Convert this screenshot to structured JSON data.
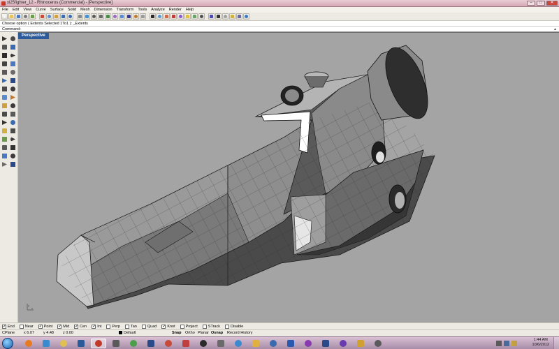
{
  "window": {
    "title": "xl25fighter_12 - Rhinoceros (Commercial) - [Perspective]",
    "minimize": "–",
    "maximize": "□",
    "close": "✕"
  },
  "menu": [
    "File",
    "Edit",
    "View",
    "Curve",
    "Surface",
    "Solid",
    "Mesh",
    "Dimension",
    "Transform",
    "Tools",
    "Analyze",
    "Render",
    "Help"
  ],
  "status_line": "Choose option ( Extents  Selected  1To1 ): _Extents",
  "command_prompt": "Command:",
  "viewport": {
    "tab_label": "Perspective",
    "axis_y": "y",
    "axis_x": "x"
  },
  "toolbar_icons": [
    "new-file-icon",
    "open-file-icon",
    "save-icon",
    "print-icon",
    "import-icon",
    "cut-icon",
    "copy-icon",
    "paste-icon",
    "undo-icon",
    "redo-icon",
    "pan-icon",
    "rotate-view-icon",
    "zoom-icon",
    "zoom-window-icon",
    "zoom-extents-icon",
    "zoom-selected-icon",
    "undo-view-icon",
    "four-views-icon",
    "set-cplane-icon",
    "grid-icon",
    "wireframe-icon",
    "shaded-icon",
    "rendered-icon",
    "render-icon",
    "material-icon",
    "light-icon",
    "layer-icon",
    "properties-icon",
    "osnap-icon",
    "select-icon",
    "hide-icon",
    "lock-icon",
    "options-icon",
    "help-icon"
  ],
  "left_tools": [
    "select-arrow-icon",
    "point-icon",
    "polyline-icon",
    "curve-icon",
    "circle-icon",
    "arc-icon",
    "ellipse-icon",
    "rectangle-icon",
    "polygon-icon",
    "freeform-icon",
    "surface-icon",
    "extrude-icon",
    "box-icon",
    "sphere-icon",
    "mesh-icon",
    "boolean-icon",
    "fillet-icon",
    "offset-icon",
    "trim-icon",
    "split-icon",
    "join-icon",
    "explode-icon",
    "move-icon",
    "copy-object-icon",
    "rotate-icon",
    "scale-icon",
    "mirror-icon",
    "array-icon",
    "dimension-icon",
    "text-icon",
    "group-icon",
    "analyze-icon"
  ],
  "osnaps": [
    {
      "label": "End",
      "checked": true
    },
    {
      "label": "Near",
      "checked": false
    },
    {
      "label": "Point",
      "checked": true
    },
    {
      "label": "Mid",
      "checked": true
    },
    {
      "label": "Cen",
      "checked": true
    },
    {
      "label": "Int",
      "checked": true
    },
    {
      "label": "Perp",
      "checked": false
    },
    {
      "label": "Tan",
      "checked": false
    },
    {
      "label": "Quad",
      "checked": false
    },
    {
      "label": "Knot",
      "checked": true
    },
    {
      "label": "Project",
      "checked": false
    },
    {
      "label": "STrack",
      "checked": false
    },
    {
      "label": "Disable",
      "checked": false
    }
  ],
  "status": {
    "cplane": "CPlane",
    "x": "x 6.07",
    "y": "y 4.48",
    "z": "z 0.00",
    "layer": "Default",
    "snap": "Snap",
    "ortho": "Ortho",
    "planar": "Planar",
    "osnap": "Osnap",
    "record_history": "Record History"
  },
  "taskbar": {
    "time": "1:44 AM",
    "date": "10/6/2012",
    "apps": [
      "firefox-icon",
      "ie-icon",
      "explorer-icon",
      "photoshop-icon",
      "rhino-icon",
      "media-icon",
      "chrome-icon",
      "ps-icon",
      "paint-icon",
      "sketchup-icon",
      "unity-icon",
      "tool-icon",
      "ie2-icon",
      "folder-icon",
      "browser-icon",
      "word-icon",
      "onenote-icon",
      "ps2-icon",
      "ae-icon",
      "winamp-icon",
      "tool2-icon"
    ]
  },
  "colors": {
    "viewport_bg": "#a4a4a4",
    "viewport_tab": "#2c5a9a",
    "model_dark": "#2e2e2e",
    "model_light": "#d2d2d2"
  }
}
